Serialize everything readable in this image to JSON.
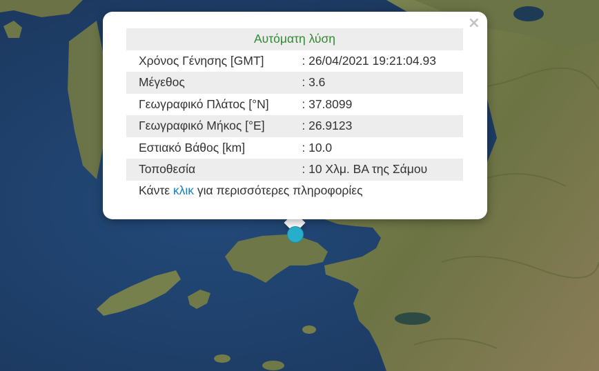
{
  "popup": {
    "title": "Αυτόματη λύση",
    "close_label": "×",
    "rows": [
      {
        "label": "Χρόνος Γένησης [GMT]",
        "value": ": 26/04/2021 19:21:04.93"
      },
      {
        "label": "Μέγεθος",
        "value": ": 3.6"
      },
      {
        "label": "Γεωγραφικό Πλάτος [°N]",
        "value": ": 37.8099"
      },
      {
        "label": "Γεωγραφικό Μήκος [°E]",
        "value": ": 26.9123"
      },
      {
        "label": "Εστιακό Βάθος [km]",
        "value": ": 10.0"
      },
      {
        "label": "Τοποθεσία",
        "value": ": 10 Χλμ. ΒΑ της Σάμου"
      }
    ],
    "more_prefix": "Κάντε ",
    "more_link": "κλικ",
    "more_suffix": " για περισσότερες πληροφορίες"
  },
  "colors": {
    "sea": "#1f3f6b",
    "land": "#6f7a4a",
    "marker": "#27aecb",
    "title_green": "#2e8b2e",
    "link_blue": "#1a7fc4"
  }
}
